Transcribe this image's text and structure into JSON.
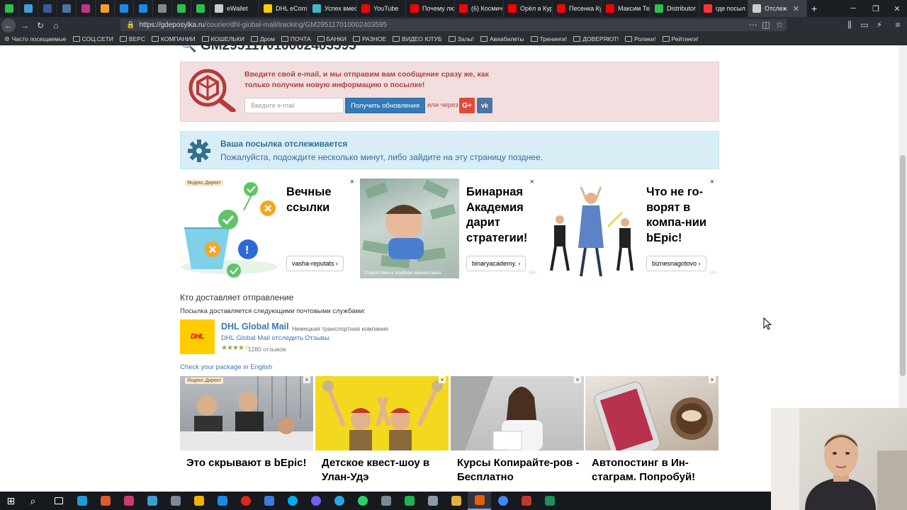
{
  "browser": {
    "tabs": [
      {
        "label": "",
        "color": "#2dbf4e",
        "pinned": true
      },
      {
        "label": "",
        "color": "#3f9fd3",
        "pinned": true
      },
      {
        "label": "",
        "color": "#3b5998",
        "pinned": true
      },
      {
        "label": "",
        "color": "#4c75a3",
        "pinned": true
      },
      {
        "label": "",
        "color": "#c13584",
        "pinned": true
      },
      {
        "label": "",
        "color": "#f59f2b",
        "pinned": true
      },
      {
        "label": "",
        "color": "#1e88e5",
        "pinned": true
      },
      {
        "label": "",
        "color": "#1e88e5",
        "pinned": true
      },
      {
        "label": "",
        "color": "#888888",
        "pinned": true
      },
      {
        "label": "",
        "color": "#2dbf4e",
        "pinned": true
      },
      {
        "label": "",
        "color": "#2dbf4e",
        "pinned": true
      },
      {
        "label": "eWallet",
        "color": "#cccccc",
        "pinned": false
      },
      {
        "label": "DHL eCom",
        "color": "#ffcc00",
        "pinned": false
      },
      {
        "label": "Успех вмес",
        "color": "#3fb7c9",
        "pinned": false
      },
      {
        "label": "YouTube",
        "color": "#ff0000",
        "pinned": false
      },
      {
        "label": "Почему лю",
        "color": "#ff0000",
        "pinned": false
      },
      {
        "label": "(6) Космич",
        "color": "#ff0000",
        "pinned": false
      },
      {
        "label": "Орёл в Кур",
        "color": "#ff0000",
        "pinned": false
      },
      {
        "label": "Песенка Ку",
        "color": "#ff0000",
        "pinned": false
      },
      {
        "label": "Максим Те",
        "color": "#ff0000",
        "pinned": false
      },
      {
        "label": "Distributor",
        "color": "#2dbf4e",
        "pinned": false
      },
      {
        "label": "где посыл",
        "color": "#ff3333",
        "pinned": false
      },
      {
        "label": "Отслеж",
        "color": "#cccccc",
        "pinned": false,
        "active": true
      }
    ],
    "url_host": "https://gdeposylka.ru",
    "url_path": "/courier/dhl-global-mail/tracking/GM295117010002403595",
    "bookmarks": [
      "Часто посещаемые",
      "СОЦ.СЕТИ",
      "ВЕРС",
      "КОМПАНИИ",
      "КОШЕЛЬКИ",
      "Дром",
      "ПОЧТА",
      "БАНКИ",
      "РАЗНОЕ",
      "ВИДЕО ЮТУБ",
      "Залы!",
      "Авиабилеты",
      "Тренинги!",
      "ДОВЕРЯЮТ!",
      "Ролики!",
      "Рейтинги!"
    ]
  },
  "page": {
    "tracking_number": "GM295117010002403595",
    "subscribe": {
      "message": "Введите свой e-mail, и мы отправим вам сообщение сразу же, как только получим новую информацию о посылке!",
      "email_placeholder": "Введите e-mail",
      "button": "Получить обновления",
      "or_text": "или через",
      "gplus": "G+",
      "vk": "vk"
    },
    "status": {
      "title": "Ваша посылка отслеживается",
      "text": "Пожалуйста, подождите несколько минут, либо зайдите на эту страницу позднее."
    },
    "ads_top": [
      {
        "title": "Вечные ссылки",
        "domain": "vasha-reputats",
        "label": "Яндекс.Директ"
      },
      {
        "title": "Бинарная Академия дарит стратегии!",
        "domain": "binaryacademy.",
        "age": "18+",
        "caption": "Содействие в подборе финансовых"
      },
      {
        "title": "Что не го-ворят в компа-нии bEpic!",
        "domain": "biznesnagotovo",
        "age": "18+"
      }
    ],
    "ad_close": "×",
    "delivery": {
      "heading": "Кто доставляет отправление",
      "sub": "Посылка доставляется следующими почтовыми службами:",
      "logo_text": "DHL",
      "name": "DHL Global Mail",
      "type": "Немецкая транспортная компания",
      "track_link": "DHL Global Mail отследить",
      "reviews_link": "Отзывы",
      "rating_stars": "★★★★☆",
      "rating": 4,
      "review_count": "1280 отзывов",
      "check_english": "Check your package in English"
    },
    "ads_bottom": [
      {
        "title": "Это скрывают в bEpic!",
        "label": "Яндекс.Директ"
      },
      {
        "title": "Детское квест-шоу в Улан-Удэ"
      },
      {
        "title": "Курсы Копирайте-ров - Бесплатно"
      },
      {
        "title": "Автопостинг в Ин-стаграм. Попробуй!"
      }
    ]
  },
  "colors": {
    "alert_red": "#a94442",
    "info_blue": "#31708f",
    "link_blue": "#3a75b7",
    "button_blue": "#337ab7",
    "dhl_yellow": "#ffcc00",
    "dhl_red": "#d40511"
  }
}
